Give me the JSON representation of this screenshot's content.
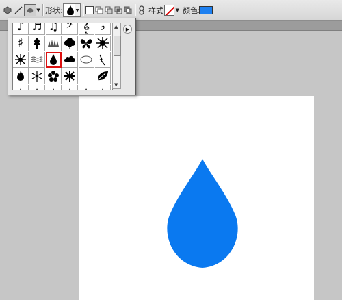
{
  "options_bar": {
    "shape_label": "形状:",
    "style_label": "样式:",
    "color_label": "颜色:",
    "color_value": "#1e80f0"
  },
  "shape_picker": {
    "selected_shape": "raindrop",
    "shapes": [
      "eighth-note",
      "sixteenth-note",
      "beamed-notes",
      "bass-clef",
      "treble-clef",
      "flat",
      "sharp",
      "tree",
      "grass",
      "clover",
      "butterfly",
      "sun-burst",
      "sun",
      "waves",
      "raindrop",
      "cloud",
      "thought-cloud",
      "lightning",
      "fire",
      "snowflake",
      "flower",
      "snow-crystal",
      "moon",
      "leaf"
    ]
  },
  "canvas": {
    "shape_fill": "#0a79f0",
    "background": "#ffffff"
  }
}
